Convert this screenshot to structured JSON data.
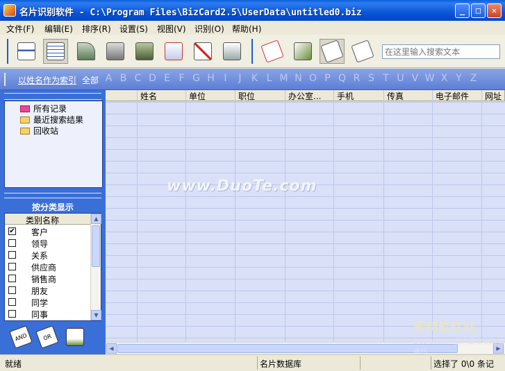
{
  "window": {
    "title": "名片识别软件 - C:\\Program Files\\BizCard2.5\\UserData\\untitled0.biz",
    "min_glyph": "_",
    "max_glyph": "□",
    "close_glyph": "✕"
  },
  "menu": [
    "文件(F)",
    "编辑(E)",
    "排序(R)",
    "设置(S)",
    "视图(V)",
    "识别(O)",
    "帮助(H)"
  ],
  "search": {
    "placeholder": "在这里输入搜索文本"
  },
  "alphabet": {
    "index_link": "以姓名作为索引",
    "all": "全部",
    "letters": [
      "A",
      "B",
      "C",
      "D",
      "E",
      "F",
      "G",
      "H",
      "I",
      "J",
      "K",
      "L",
      "M",
      "N",
      "O",
      "P",
      "Q",
      "R",
      "S",
      "T",
      "U",
      "V",
      "W",
      "X",
      "Y",
      "Z"
    ]
  },
  "tree": {
    "items": [
      {
        "label": "所有记录",
        "icon": "pink-folder-icon"
      },
      {
        "label": "最近搜索结果",
        "icon": "folder-icon"
      },
      {
        "label": "回收站",
        "icon": "folder-icon"
      }
    ]
  },
  "categories": {
    "title": "按分类显示",
    "header": "类别名称",
    "items": [
      {
        "label": "客户",
        "checked": true
      },
      {
        "label": "领导",
        "checked": false
      },
      {
        "label": "关系",
        "checked": false
      },
      {
        "label": "供应商",
        "checked": false
      },
      {
        "label": "销售商",
        "checked": false
      },
      {
        "label": "朋友",
        "checked": false
      },
      {
        "label": "同学",
        "checked": false
      },
      {
        "label": "同事",
        "checked": false
      }
    ],
    "buttons": [
      "AND",
      "OR"
    ]
  },
  "grid": {
    "columns": [
      "",
      "姓名",
      "单位",
      "职位",
      "办公室...",
      "手机",
      "传真",
      "电子邮件",
      "网址"
    ]
  },
  "watermark": "www.DuoTe.com",
  "corner_logo": {
    "main": "多特软件站",
    "sub": "DuoTe.Com 国内最安全的软件站"
  },
  "status": {
    "left": "就绪",
    "db": "名片数据库",
    "selection": "选择了 0\\0 条记"
  },
  "colors": {
    "title_bar": "#0a56d6",
    "left_panel": "#3a6fd8",
    "grid_bg": "#d9e0f7"
  }
}
